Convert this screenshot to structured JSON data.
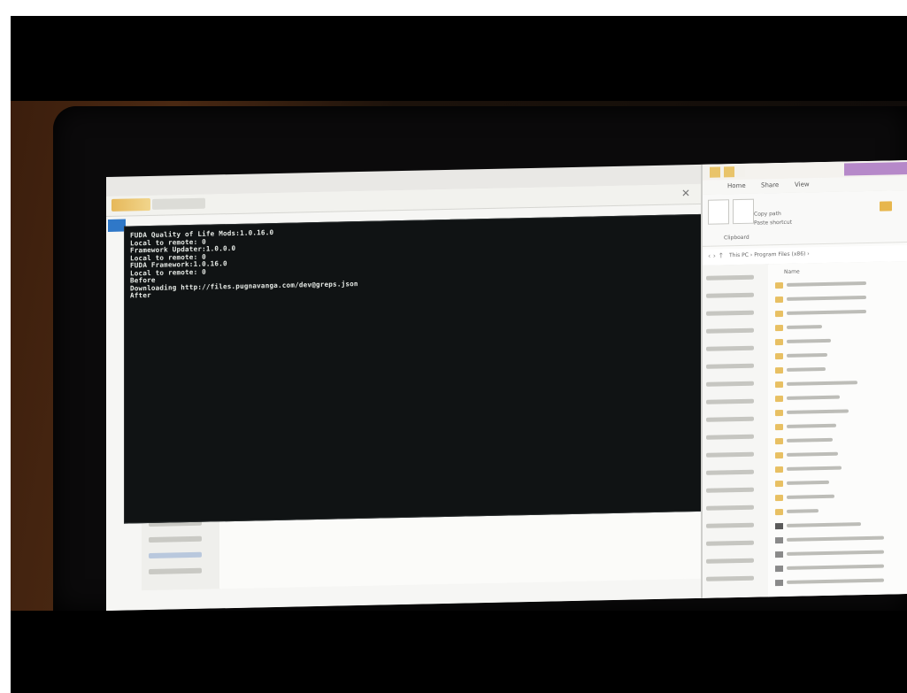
{
  "console": {
    "lines": [
      "FUDA Quality of Life Mods:1.0.16.0",
      "Local to remote: 0",
      "Framework Updater:1.0.0.0",
      "Local to remote: 0",
      "FUDA Framework:1.0.16.0",
      "Local to remote: 0",
      "Before",
      "Downloading http://files.pugnavanga.com/dev@greps.json",
      "After"
    ]
  },
  "explorer": {
    "menu": [
      "Home",
      "Share",
      "View"
    ],
    "ribbon": {
      "copy_path": "Copy path",
      "paste_shortcut": "Paste shortcut",
      "section": "Clipboard"
    },
    "address": "This PC › Program Files (x86) ›",
    "column_header": "Name"
  },
  "colors": {
    "console_bg": "#101314",
    "console_text": "#e8ece8",
    "accent_tab": "#2f78c8",
    "title_accent": "#b689c9",
    "folder": "#e8c063"
  }
}
